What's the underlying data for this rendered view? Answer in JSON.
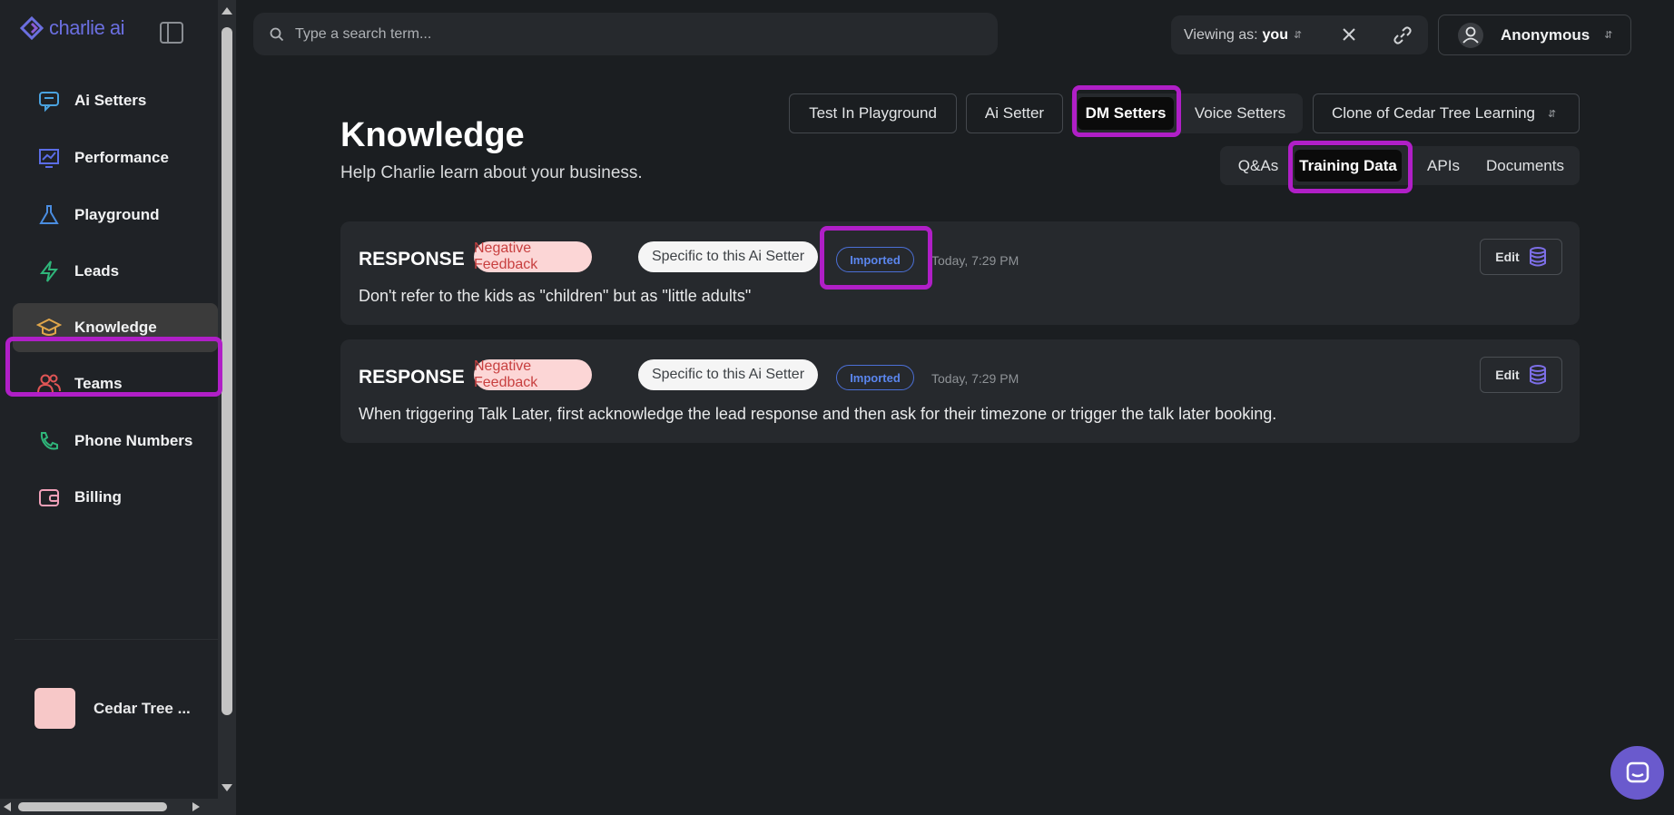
{
  "brand": {
    "logo_text": "charlie ai",
    "accent": "#6b6fe0"
  },
  "sidebar": {
    "items": [
      {
        "label": "Ai Setters",
        "icon": "chat-icon",
        "color": "#4aa3e0"
      },
      {
        "label": "Performance",
        "icon": "chart-icon",
        "color": "#5b6de6"
      },
      {
        "label": "Playground",
        "icon": "flask-icon",
        "color": "#4a8de0"
      },
      {
        "label": "Leads",
        "icon": "bolt-icon",
        "color": "#2fb67a"
      },
      {
        "label": "Knowledge",
        "icon": "graduation-cap-icon",
        "color": "#e0a64a",
        "active": true
      },
      {
        "label": "Teams",
        "icon": "users-icon",
        "color": "#e05555"
      },
      {
        "label": "Phone Numbers",
        "icon": "phone-icon",
        "color": "#2fb67a"
      },
      {
        "label": "Billing",
        "icon": "wallet-icon",
        "color": "#f0a0b8"
      }
    ],
    "workspace": {
      "name": "Cedar Tree ..."
    }
  },
  "topbar": {
    "search_placeholder": "Type a search term...",
    "viewing_label": "Viewing as:",
    "viewing_value": "you",
    "user_name": "Anonymous"
  },
  "header": {
    "title": "Knowledge",
    "subtitle": "Help Charlie learn about your business."
  },
  "actions": {
    "test_playground": "Test In Playground",
    "ai_setter": "Ai Setter",
    "setter_types": [
      "DM Setters",
      "Voice Setters"
    ],
    "active_setter_type": "DM Setters",
    "selected_setter": "Clone of Cedar Tree Learning"
  },
  "tabs": {
    "items": [
      "Q&As",
      "Training Data",
      "APIs",
      "Documents"
    ],
    "active": "Training Data"
  },
  "entries": [
    {
      "kind": "RESPONSE",
      "tag_feedback": "Negative Feedback",
      "tag_scope": "Specific to this Ai Setter",
      "tag_source": "Imported",
      "time": "Today, 7:29 PM",
      "text": "Don't refer to the kids as \"children\" but as \"little adults\"",
      "edit_label": "Edit"
    },
    {
      "kind": "RESPONSE",
      "tag_feedback": "Negative Feedback",
      "tag_scope": "Specific to this Ai Setter",
      "tag_source": "Imported",
      "time": "Today, 7:29 PM",
      "text": "When triggering Talk Later, first acknowledge the lead response and then ask for their timezone or trigger the talk later booking.",
      "edit_label": "Edit"
    }
  ],
  "highlight_color": "#b01fc7"
}
